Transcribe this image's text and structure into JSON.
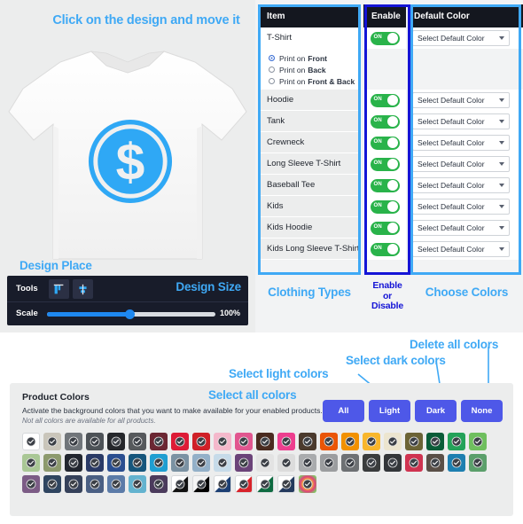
{
  "designer": {
    "annotation_top": "Click on the design and move it",
    "annotation_design_place": "Design Place",
    "annotation_design_size": "Design Size",
    "tools_label": "Tools",
    "scale_label": "Scale",
    "scale_value": "100%",
    "scale_percent": 50,
    "tool_icons": [
      "align-vertical-center-icon",
      "align-horizontal-center-icon"
    ],
    "shirt_color": "#ffffff",
    "design_logo": "dollar-coin-icon",
    "design_logo_color": "#2fa8f5"
  },
  "table": {
    "headers": {
      "item": "Item",
      "enable": "Enable",
      "default_color": "Default Color"
    },
    "rows": [
      {
        "name": "T-Shirt",
        "enabled": true,
        "toggle_label": "ON",
        "default_color": "Select Default Color"
      },
      {
        "name": "Hoodie",
        "enabled": true,
        "toggle_label": "ON",
        "default_color": "Select Default Color"
      },
      {
        "name": "Tank",
        "enabled": true,
        "toggle_label": "ON",
        "default_color": "Select Default Color"
      },
      {
        "name": "Crewneck",
        "enabled": true,
        "toggle_label": "ON",
        "default_color": "Select Default Color"
      },
      {
        "name": "Long Sleeve T-Shirt",
        "enabled": true,
        "toggle_label": "ON",
        "default_color": "Select Default Color"
      },
      {
        "name": "Baseball Tee",
        "enabled": true,
        "toggle_label": "ON",
        "default_color": "Select Default Color"
      },
      {
        "name": "Kids",
        "enabled": true,
        "toggle_label": "ON",
        "default_color": "Select Default Color"
      },
      {
        "name": "Kids Hoodie",
        "enabled": true,
        "toggle_label": "ON",
        "default_color": "Select Default Color"
      },
      {
        "name": "Kids Long Sleeve T-Shirt",
        "enabled": true,
        "toggle_label": "ON",
        "default_color": "Select Default Color"
      }
    ],
    "print_options": [
      {
        "prefix": "Print on ",
        "bold": "Front",
        "selected": true
      },
      {
        "prefix": "Print on ",
        "bold": "Back",
        "selected": false
      },
      {
        "prefix": "Print on ",
        "bold": "Front & Back",
        "selected": false
      }
    ]
  },
  "annotations": {
    "clothing_types": "Clothing Types",
    "enable_or_disable": "Enable\nor\nDisable",
    "enable_line1": "Enable",
    "enable_line2": "or",
    "enable_line3": "Disable",
    "choose_colors": "Choose Colors",
    "select_all_colors": "Select all colors",
    "select_light_colors": "Select light colors",
    "select_dark_colors": "Select dark colors",
    "delete_all_colors": "Delete all colors",
    "accent_color": "#3fa9f5",
    "enable_box_color": "#1414d6"
  },
  "product_colors": {
    "title": "Product Colors",
    "description": "Activate the background colors that you want to make available for your enabled products.",
    "note": "Not all colors are available for all products.",
    "buttons": [
      {
        "label": "All"
      },
      {
        "label": "Light"
      },
      {
        "label": "Dark"
      },
      {
        "label": "None"
      }
    ],
    "button_color": "#4e58e8",
    "swatches": [
      {
        "color": "#ffffff",
        "selected": true
      },
      {
        "color": "#c9c5ba",
        "selected": true
      },
      {
        "color": "#70757a",
        "selected": true
      },
      {
        "color": "#4d5257",
        "selected": true
      },
      {
        "color": "#25272b",
        "selected": true
      },
      {
        "color": "#56595c",
        "selected": true
      },
      {
        "color": "#6b2733",
        "selected": true
      },
      {
        "color": "#dd1b36",
        "selected": true
      },
      {
        "color": "#cf2027",
        "selected": true
      },
      {
        "color": "#f4b8cb",
        "selected": true
      },
      {
        "color": "#e1568f",
        "selected": true
      },
      {
        "color": "#4a2b20",
        "selected": true
      },
      {
        "color": "#ed3e8e",
        "selected": true
      },
      {
        "color": "#4b3a2d",
        "selected": true
      },
      {
        "color": "#ea5507",
        "selected": true
      },
      {
        "color": "#f29100",
        "selected": true
      },
      {
        "color": "#f8b62b",
        "selected": true
      },
      {
        "color": "#ece5cf",
        "selected": true
      },
      {
        "color": "#6b6336",
        "selected": true
      },
      {
        "color": "#0a5c38",
        "selected": true
      },
      {
        "color": "#24a259",
        "selected": true
      },
      {
        "color": "#6fbf5e",
        "selected": true
      },
      {
        "color": "#a9c795",
        "selected": true
      },
      {
        "color": "#8d9a6e",
        "selected": true
      },
      {
        "color": "#22262f",
        "selected": true
      },
      {
        "color": "#2a3a66",
        "selected": true
      },
      {
        "color": "#2a4e90",
        "selected": true
      },
      {
        "color": "#16567c",
        "selected": true
      },
      {
        "color": "#1f9ed1",
        "selected": true
      },
      {
        "color": "#7b92a3",
        "selected": true
      },
      {
        "color": "#93b0c8",
        "selected": true
      },
      {
        "color": "#c6dbe9",
        "selected": true
      },
      {
        "color": "#6b4379",
        "selected": true
      },
      {
        "color": "#e3e3e3",
        "selected": true
      },
      {
        "color": "#dcdcdc",
        "selected": true
      },
      {
        "color": "#a9abad",
        "selected": true
      },
      {
        "color": "#9b9d9f",
        "selected": true
      },
      {
        "color": "#6d7073",
        "selected": true
      },
      {
        "color": "#3a3c3d",
        "selected": true
      },
      {
        "color": "#33363a",
        "selected": true
      },
      {
        "color": "#cf3350",
        "selected": true
      },
      {
        "color": "#5a4f47",
        "selected": true
      },
      {
        "color": "#1d7fb0",
        "selected": true
      },
      {
        "color": "#5b9f6b",
        "selected": true
      },
      {
        "color": "#7c5c86",
        "selected": true
      },
      {
        "color": "#2f4560",
        "selected": true
      },
      {
        "color": "#35415a",
        "selected": true
      },
      {
        "color": "#4a5f83",
        "selected": true
      },
      {
        "color": "#5b7ba8",
        "selected": true
      },
      {
        "color": "#63b3cf",
        "selected": true
      },
      {
        "color": "#4b3b5c",
        "selected": true
      },
      {
        "color": "#ffffff",
        "selected": true,
        "diagonal": "#111111"
      },
      {
        "color": "#f5f5f5",
        "selected": true,
        "diagonal": "#000000"
      },
      {
        "color": "#ffffff",
        "selected": true,
        "diagonal": "#1c3f73"
      },
      {
        "color": "#ffffff",
        "selected": true,
        "diagonal": "#d8232a"
      },
      {
        "color": "#ffffff",
        "selected": true,
        "diagonal": "#0e6b41"
      },
      {
        "color": "#ffffff",
        "selected": true,
        "diagonal": "#243a5e"
      },
      {
        "color": "#f3b64a",
        "selected": true,
        "rainbow": true
      }
    ]
  }
}
